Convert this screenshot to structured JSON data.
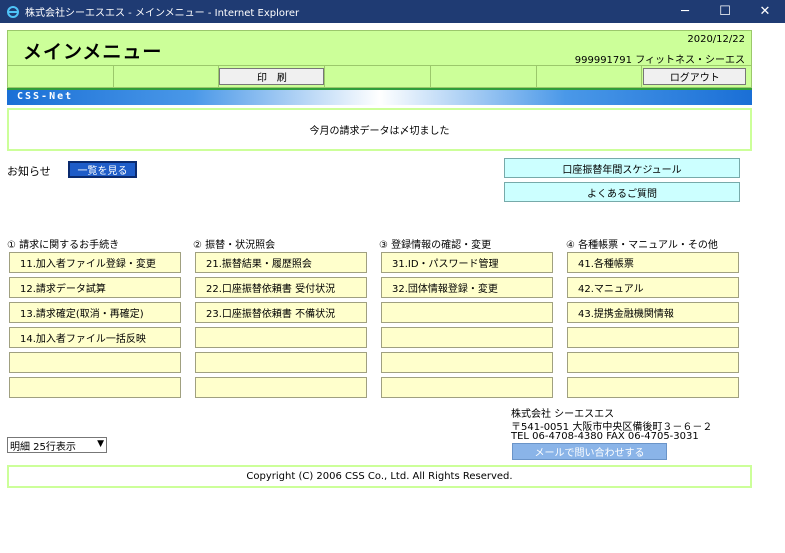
{
  "window": {
    "title": "株式会社シーエスエス - メインメニュー - Internet Explorer",
    "minimize": "─",
    "maximize": "☐",
    "close": "✕"
  },
  "header": {
    "title": "メインメニュー",
    "date": "2020/12/22",
    "company": "999991791 フィットネス・シーエス"
  },
  "toolbar": {
    "print_label": "印　刷",
    "logout_label": "ログアウト"
  },
  "brand": {
    "text": "CSS-Net"
  },
  "notice": {
    "text": "今月の請求データは〆切ました"
  },
  "news": {
    "label": "お知らせ",
    "button": "一覧を見る"
  },
  "side_buttons": {
    "schedule": "口座振替年間スケジュール",
    "faq": "よくあるご質問"
  },
  "sections": [
    {
      "heading": "① 請求に関するお手続き",
      "items": [
        "11.加入者ファイル登録・変更",
        "12.請求データ試算",
        "13.請求確定(取消・再確定)",
        "14.加入者ファイル一括反映",
        "",
        ""
      ]
    },
    {
      "heading": "② 振替・状況照会",
      "items": [
        "21.振替結果・履歴照会",
        "22.口座振替依頼書 受付状況",
        "23.口座振替依頼書 不備状況",
        "",
        "",
        ""
      ]
    },
    {
      "heading": "③ 登録情報の確認・変更",
      "items": [
        "31.ID・パスワード管理",
        "32.団体情報登録・変更",
        "",
        "",
        "",
        ""
      ]
    },
    {
      "heading": "④ 各種帳票・マニュアル・その他",
      "items": [
        "41.各種帳票",
        "42.マニュアル",
        "43.提携金融機関情報",
        "",
        "",
        ""
      ]
    }
  ],
  "select": {
    "value": "明細 25行表示"
  },
  "address": {
    "company": "株式会社 シーエスエス",
    "postal": "〒541-0051 大阪市中央区備後町３－６－２",
    "tel": "TEL 06-4708-4380 FAX 06-4705-3031",
    "mail_button": "メールで問い合わせする"
  },
  "footer": {
    "copyright": "Copyright (C) 2006 CSS Co., Ltd. All Rights Reserved."
  }
}
